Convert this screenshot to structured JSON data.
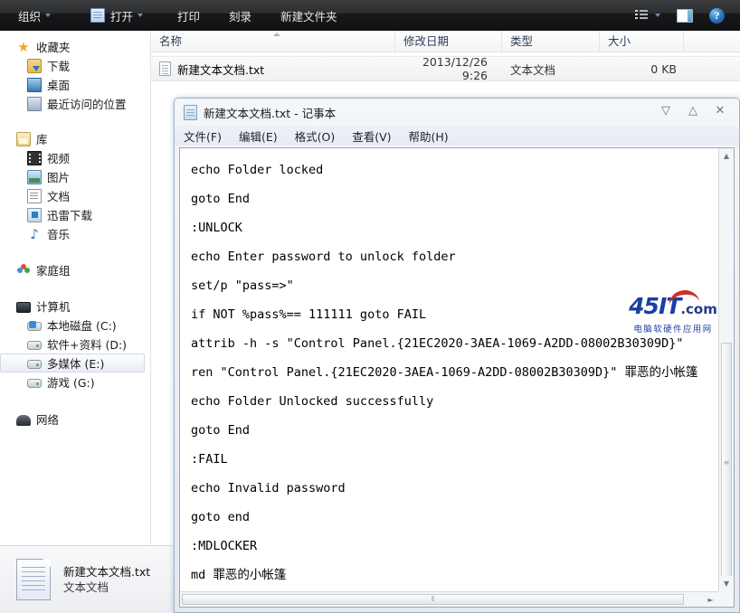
{
  "explorer": {
    "toolbar": {
      "items": [
        {
          "label": "组织",
          "icon": "",
          "caret": true
        },
        {
          "label": "打开",
          "icon": "notepad-icon",
          "caret": true
        },
        {
          "label": "打印",
          "icon": "",
          "caret": false
        },
        {
          "label": "刻录",
          "icon": "",
          "caret": false
        },
        {
          "label": "新建文件夹",
          "icon": "",
          "caret": false
        }
      ],
      "right_items": [
        {
          "name": "view-list-icon"
        },
        {
          "name": "preview-pane-icon"
        },
        {
          "name": "help-icon",
          "label": "?"
        }
      ]
    },
    "sidebar": {
      "groups": [
        {
          "header": {
            "label": "收藏夹",
            "icon": "star-icon"
          },
          "items": [
            {
              "label": "下载",
              "icon": "downloads-icon"
            },
            {
              "label": "桌面",
              "icon": "desktop-icon"
            },
            {
              "label": "最近访问的位置",
              "icon": "recent-places-icon"
            }
          ]
        },
        {
          "header": {
            "label": "库",
            "icon": "library-icon"
          },
          "items": [
            {
              "label": "视频",
              "icon": "video-icon"
            },
            {
              "label": "图片",
              "icon": "pictures-icon"
            },
            {
              "label": "文档",
              "icon": "documents-icon"
            },
            {
              "label": "迅雷下载",
              "icon": "xunlei-icon"
            },
            {
              "label": "音乐",
              "icon": "music-icon"
            }
          ]
        },
        {
          "header": {
            "label": "家庭组",
            "icon": "homegroup-icon"
          },
          "items": []
        },
        {
          "header": {
            "label": "计算机",
            "icon": "computer-icon"
          },
          "items": [
            {
              "label": "本地磁盘 (C:)",
              "icon": "drive-system-icon",
              "selected": false
            },
            {
              "label": "软件+资料 (D:)",
              "icon": "drive-icon",
              "selected": false
            },
            {
              "label": "多媒体 (E:)",
              "icon": "drive-icon",
              "selected": true
            },
            {
              "label": "游戏 (G:)",
              "icon": "drive-icon",
              "selected": false
            }
          ]
        },
        {
          "header": {
            "label": "网络",
            "icon": "network-icon"
          },
          "items": []
        }
      ]
    },
    "columns": [
      {
        "label": "名称",
        "sorted": true
      },
      {
        "label": "修改日期",
        "sorted": false
      },
      {
        "label": "类型",
        "sorted": false
      },
      {
        "label": "大小",
        "sorted": false
      }
    ],
    "rows": [
      {
        "name": "新建文本文档.txt",
        "date": "2013/12/26 9:26",
        "type": "文本文档",
        "size": "0 KB",
        "icon": "text-file-icon"
      }
    ],
    "details": {
      "title": "新建文本文档.txt",
      "subtitle": "文本文档",
      "icon": "text-file-large-icon"
    }
  },
  "notepad": {
    "title": "新建文本文档.txt - 记事本",
    "icon": "notepad-icon",
    "window_buttons": [
      {
        "name": "minimize-button",
        "glyph": "▽"
      },
      {
        "name": "maximize-button",
        "glyph": "△"
      },
      {
        "name": "close-button",
        "glyph": "✕"
      }
    ],
    "menu": [
      {
        "label": "文件(F)"
      },
      {
        "label": "编辑(E)"
      },
      {
        "label": "格式(O)"
      },
      {
        "label": "查看(V)"
      },
      {
        "label": "帮助(H)"
      }
    ],
    "lines": [
      "echo Folder locked",
      "goto End",
      ":UNLOCK",
      "echo Enter password to unlock folder",
      "set/p \"pass=>\"",
      "if NOT %pass%== 111111 goto FAIL",
      "attrib -h -s \"Control Panel.{21EC2020-3AEA-1069-A2DD-08002B30309D}\"",
      "ren \"Control Panel.{21EC2020-3AEA-1069-A2DD-08002B30309D}\" 罪恶的小帐篷",
      "echo Folder Unlocked successfully",
      "goto End",
      ":FAIL",
      "echo Invalid password",
      "goto end",
      ":MDLOCKER",
      "md 罪恶的小帐篷"
    ],
    "scrollbar": {
      "v_up": "▲",
      "v_down": "▼",
      "h_left": "◄",
      "h_right": "►",
      "v_grip": "≡",
      "h_grip": "⦀"
    }
  },
  "watermark": {
    "main": "45IT",
    "suffix": ".com",
    "sub": "电脑软硬件应用网"
  }
}
